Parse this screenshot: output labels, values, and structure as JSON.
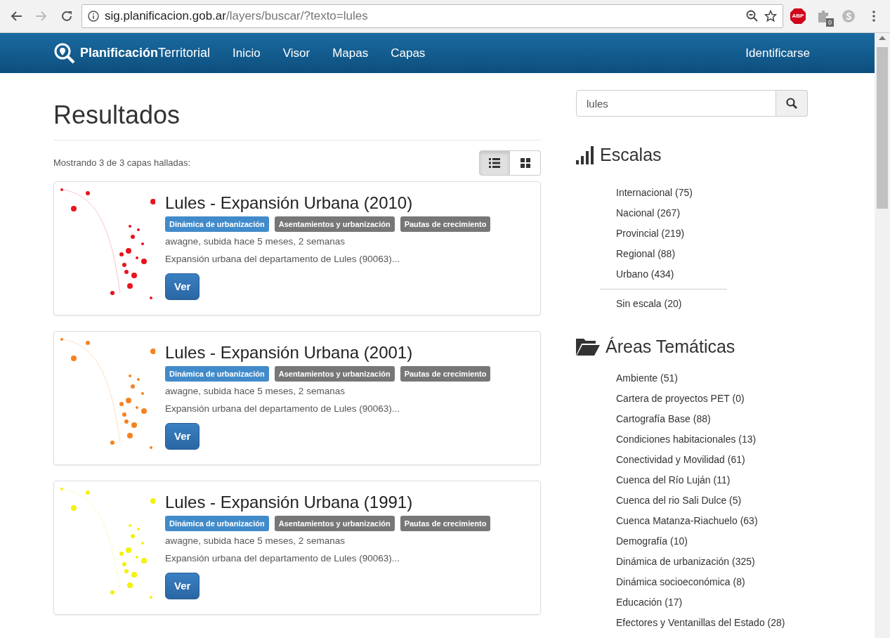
{
  "browser": {
    "url_host": "sig.planificacion.gob.ar",
    "url_path": "/layers/buscar/?texto=lules",
    "extension_badge": "0",
    "abp_label": "ABP"
  },
  "navbar": {
    "brand_bold": "Planificación",
    "brand_rest": "Territorial",
    "links": [
      {
        "label": "Inicio"
      },
      {
        "label": "Visor"
      },
      {
        "label": "Mapas"
      },
      {
        "label": "Capas"
      }
    ],
    "login": "Identificarse"
  },
  "main": {
    "title": "Resultados",
    "summary": "Mostrando 3 de 3 capas halladas:",
    "views": [
      {
        "kind": "list",
        "selected": true
      },
      {
        "kind": "grid",
        "selected": false
      }
    ],
    "results": [
      {
        "title": "Lules - Expansión Urbana (2010)",
        "color": "#e8141e",
        "tags": [
          {
            "label": "Dinámica de urbanización",
            "color": "#428bca"
          },
          {
            "label": "Asentamientos y urbanización",
            "color": "#777777"
          },
          {
            "label": "Pautas de crecimiento",
            "color": "#777777"
          }
        ],
        "meta": "awagne, subida hace 5 meses, 2 semanas",
        "description": "Expansión urbana del departamento de Lules (90063)...",
        "button": "Ver"
      },
      {
        "title": "Lules - Expansión Urbana (2001)",
        "color": "#f5821e",
        "tags": [
          {
            "label": "Dinámica de urbanización",
            "color": "#428bca"
          },
          {
            "label": "Asentamientos y urbanización",
            "color": "#777777"
          },
          {
            "label": "Pautas de crecimiento",
            "color": "#777777"
          }
        ],
        "meta": "awagne, subida hace 5 meses, 2 semanas",
        "description": "Expansión urbana del departamento de Lules (90063)...",
        "button": "Ver"
      },
      {
        "title": "Lules - Expansión Urbana (1991)",
        "color": "#f2f20a",
        "tags": [
          {
            "label": "Dinámica de urbanización",
            "color": "#428bca"
          },
          {
            "label": "Asentamientos y urbanización",
            "color": "#777777"
          },
          {
            "label": "Pautas de crecimiento",
            "color": "#777777"
          }
        ],
        "meta": "awagne, subida hace 5 meses, 2 semanas",
        "description": "Expansión urbana del departamento de Lules (90063)...",
        "button": "Ver"
      }
    ]
  },
  "sidebar": {
    "search": {
      "value": "lules"
    },
    "scales": {
      "title": "Escalas",
      "items": [
        {
          "label": "Internacional (75)"
        },
        {
          "label": "Nacional (267)"
        },
        {
          "label": "Provincial (219)"
        },
        {
          "label": "Regional (88)"
        },
        {
          "label": "Urbano (434)"
        }
      ],
      "extra": "Sin escala (20)"
    },
    "areas": {
      "title": "Áreas Temáticas",
      "items": [
        {
          "label": "Ambiente (51)"
        },
        {
          "label": "Cartera de proyectos PET (0)"
        },
        {
          "label": "Cartografía Base (88)"
        },
        {
          "label": "Condiciones habitacionales (13)"
        },
        {
          "label": "Conectividad y Movilidad (61)"
        },
        {
          "label": "Cuenca del Río Luján (11)"
        },
        {
          "label": "Cuenca del rio Sali Dulce (5)"
        },
        {
          "label": "Cuenca Matanza-Riachuelo (63)"
        },
        {
          "label": "Demografía (10)"
        },
        {
          "label": "Dinámica de urbanización (325)"
        },
        {
          "label": "Dinámica socioeconómica (8)"
        },
        {
          "label": "Educación (17)"
        },
        {
          "label": "Efectores y Ventanillas del Estado (28)"
        }
      ]
    }
  }
}
